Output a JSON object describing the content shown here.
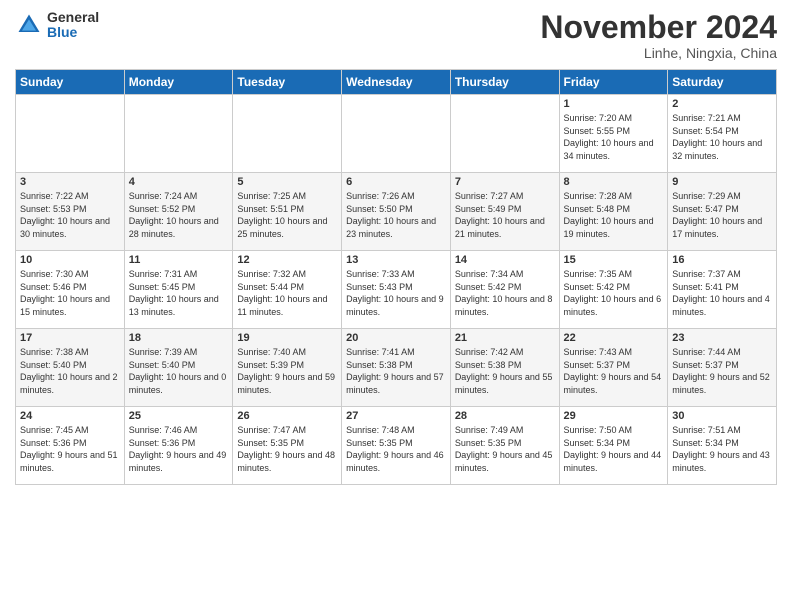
{
  "header": {
    "logo": {
      "general": "General",
      "blue": "Blue"
    },
    "title": "November 2024",
    "location": "Linhe, Ningxia, China"
  },
  "weekdays": [
    "Sunday",
    "Monday",
    "Tuesday",
    "Wednesday",
    "Thursday",
    "Friday",
    "Saturday"
  ],
  "weeks": [
    [
      {
        "day": "",
        "info": ""
      },
      {
        "day": "",
        "info": ""
      },
      {
        "day": "",
        "info": ""
      },
      {
        "day": "",
        "info": ""
      },
      {
        "day": "",
        "info": ""
      },
      {
        "day": "1",
        "info": "Sunrise: 7:20 AM\nSunset: 5:55 PM\nDaylight: 10 hours and 34 minutes."
      },
      {
        "day": "2",
        "info": "Sunrise: 7:21 AM\nSunset: 5:54 PM\nDaylight: 10 hours and 32 minutes."
      }
    ],
    [
      {
        "day": "3",
        "info": "Sunrise: 7:22 AM\nSunset: 5:53 PM\nDaylight: 10 hours and 30 minutes."
      },
      {
        "day": "4",
        "info": "Sunrise: 7:24 AM\nSunset: 5:52 PM\nDaylight: 10 hours and 28 minutes."
      },
      {
        "day": "5",
        "info": "Sunrise: 7:25 AM\nSunset: 5:51 PM\nDaylight: 10 hours and 25 minutes."
      },
      {
        "day": "6",
        "info": "Sunrise: 7:26 AM\nSunset: 5:50 PM\nDaylight: 10 hours and 23 minutes."
      },
      {
        "day": "7",
        "info": "Sunrise: 7:27 AM\nSunset: 5:49 PM\nDaylight: 10 hours and 21 minutes."
      },
      {
        "day": "8",
        "info": "Sunrise: 7:28 AM\nSunset: 5:48 PM\nDaylight: 10 hours and 19 minutes."
      },
      {
        "day": "9",
        "info": "Sunrise: 7:29 AM\nSunset: 5:47 PM\nDaylight: 10 hours and 17 minutes."
      }
    ],
    [
      {
        "day": "10",
        "info": "Sunrise: 7:30 AM\nSunset: 5:46 PM\nDaylight: 10 hours and 15 minutes."
      },
      {
        "day": "11",
        "info": "Sunrise: 7:31 AM\nSunset: 5:45 PM\nDaylight: 10 hours and 13 minutes."
      },
      {
        "day": "12",
        "info": "Sunrise: 7:32 AM\nSunset: 5:44 PM\nDaylight: 10 hours and 11 minutes."
      },
      {
        "day": "13",
        "info": "Sunrise: 7:33 AM\nSunset: 5:43 PM\nDaylight: 10 hours and 9 minutes."
      },
      {
        "day": "14",
        "info": "Sunrise: 7:34 AM\nSunset: 5:42 PM\nDaylight: 10 hours and 8 minutes."
      },
      {
        "day": "15",
        "info": "Sunrise: 7:35 AM\nSunset: 5:42 PM\nDaylight: 10 hours and 6 minutes."
      },
      {
        "day": "16",
        "info": "Sunrise: 7:37 AM\nSunset: 5:41 PM\nDaylight: 10 hours and 4 minutes."
      }
    ],
    [
      {
        "day": "17",
        "info": "Sunrise: 7:38 AM\nSunset: 5:40 PM\nDaylight: 10 hours and 2 minutes."
      },
      {
        "day": "18",
        "info": "Sunrise: 7:39 AM\nSunset: 5:40 PM\nDaylight: 10 hours and 0 minutes."
      },
      {
        "day": "19",
        "info": "Sunrise: 7:40 AM\nSunset: 5:39 PM\nDaylight: 9 hours and 59 minutes."
      },
      {
        "day": "20",
        "info": "Sunrise: 7:41 AM\nSunset: 5:38 PM\nDaylight: 9 hours and 57 minutes."
      },
      {
        "day": "21",
        "info": "Sunrise: 7:42 AM\nSunset: 5:38 PM\nDaylight: 9 hours and 55 minutes."
      },
      {
        "day": "22",
        "info": "Sunrise: 7:43 AM\nSunset: 5:37 PM\nDaylight: 9 hours and 54 minutes."
      },
      {
        "day": "23",
        "info": "Sunrise: 7:44 AM\nSunset: 5:37 PM\nDaylight: 9 hours and 52 minutes."
      }
    ],
    [
      {
        "day": "24",
        "info": "Sunrise: 7:45 AM\nSunset: 5:36 PM\nDaylight: 9 hours and 51 minutes."
      },
      {
        "day": "25",
        "info": "Sunrise: 7:46 AM\nSunset: 5:36 PM\nDaylight: 9 hours and 49 minutes."
      },
      {
        "day": "26",
        "info": "Sunrise: 7:47 AM\nSunset: 5:35 PM\nDaylight: 9 hours and 48 minutes."
      },
      {
        "day": "27",
        "info": "Sunrise: 7:48 AM\nSunset: 5:35 PM\nDaylight: 9 hours and 46 minutes."
      },
      {
        "day": "28",
        "info": "Sunrise: 7:49 AM\nSunset: 5:35 PM\nDaylight: 9 hours and 45 minutes."
      },
      {
        "day": "29",
        "info": "Sunrise: 7:50 AM\nSunset: 5:34 PM\nDaylight: 9 hours and 44 minutes."
      },
      {
        "day": "30",
        "info": "Sunrise: 7:51 AM\nSunset: 5:34 PM\nDaylight: 9 hours and 43 minutes."
      }
    ]
  ]
}
